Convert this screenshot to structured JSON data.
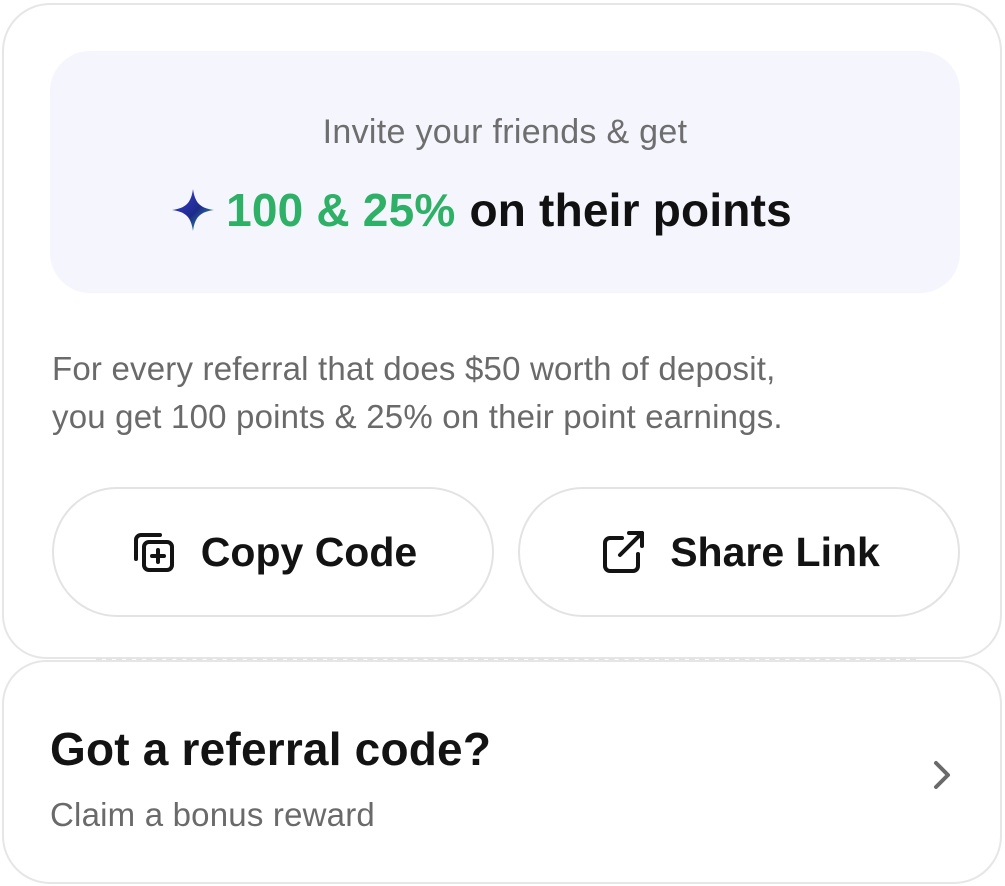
{
  "invite": {
    "subtitle": "Invite your friends & get",
    "highlight": "100 & 25%",
    "suffix": "on their points",
    "accent_color": "#2eb067",
    "icon": "sparkle-star-icon"
  },
  "description": {
    "line1": "For every referral that does $50 worth of deposit,",
    "line2": "you get 100 points & 25% on their point earnings."
  },
  "actions": {
    "copy_label": "Copy Code",
    "copy_icon": "copy-plus-icon",
    "share_label": "Share Link",
    "share_icon": "external-link-icon"
  },
  "referral": {
    "title": "Got a referral code?",
    "subtitle": "Claim a bonus reward",
    "icon": "chevron-right-icon"
  }
}
